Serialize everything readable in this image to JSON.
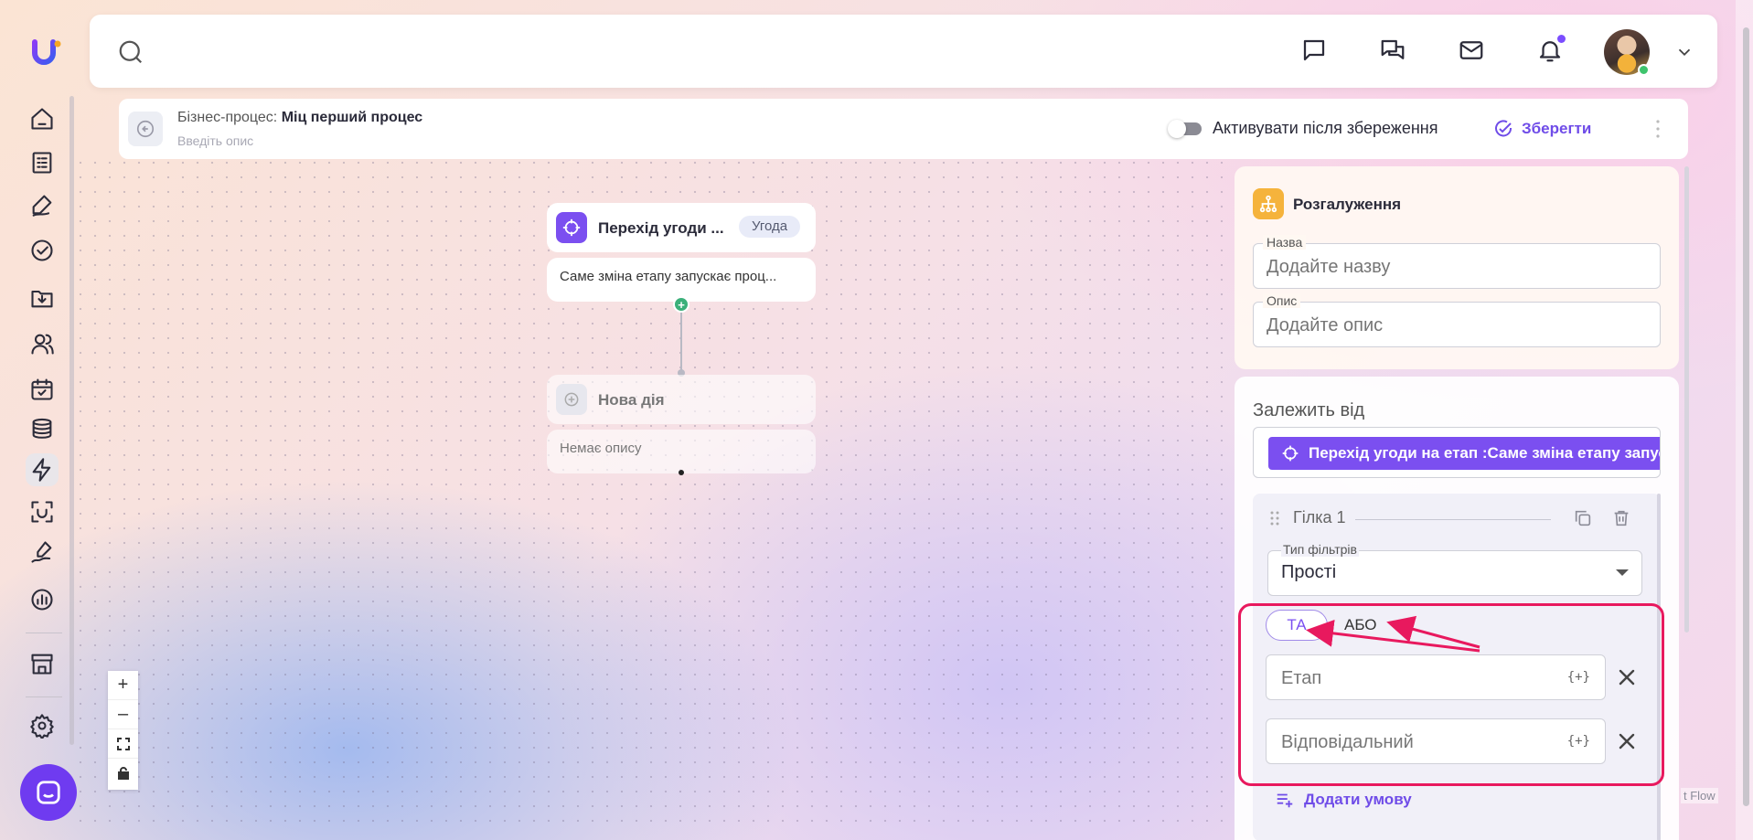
{
  "header": {
    "search_placeholder": "",
    "icons": [
      "search-icon",
      "message-icon",
      "chats-icon",
      "mail-icon",
      "bell-icon",
      "chevron-down-icon"
    ]
  },
  "process": {
    "title_prefix": "Бізнес-процес:",
    "title": "Міц перший процес",
    "description_placeholder": "Введіть опис",
    "activate_label": "Активувати після збереження",
    "activate_on": false,
    "save_label": "Зберегти"
  },
  "flow": {
    "trigger_node": {
      "title": "Перехід угоди ...",
      "badge": "Угода",
      "description": "Саме зміна етапу запускає проц..."
    },
    "new_node": {
      "title": "Нова дія",
      "description": "Немає опису"
    },
    "zoom_controls": [
      "+",
      "–"
    ],
    "attribution": "t Flow"
  },
  "panel": {
    "title": "Розгалуження",
    "name_label": "Назва",
    "name_placeholder": "Додайте назву",
    "desc_label": "Опис",
    "desc_placeholder": "Додайте опис",
    "depends_label": "Залежить від",
    "depends_chip": "Перехід угоди на етап :Саме зміна етапу запускає процес",
    "branch": {
      "name": "Гілка 1",
      "filter_type_label": "Тип фільтрів",
      "filter_type_value": "Прості",
      "logic_and": "ТА",
      "logic_or": "АБО",
      "conditions": [
        {
          "placeholder": "Етап",
          "var": "{+}"
        },
        {
          "placeholder": "Відповідальний",
          "var": "{+}"
        }
      ],
      "add_condition": "Додати умову"
    }
  },
  "colors": {
    "accent": "#7b4ff0",
    "highlight": "#e8195e",
    "branch_icon": "#f5b33c",
    "connector_add": "#3bb07a"
  }
}
